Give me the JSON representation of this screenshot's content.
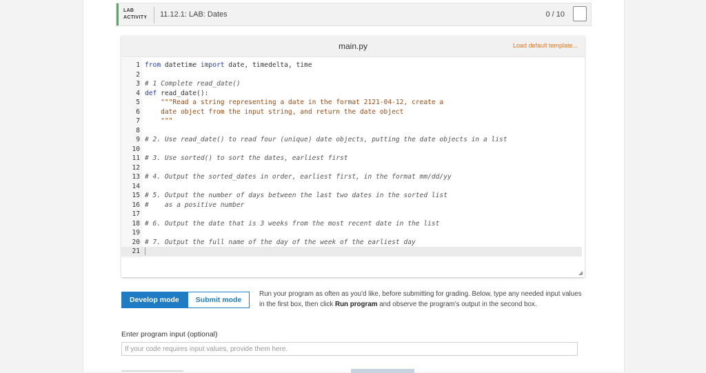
{
  "lab": {
    "badge_line1": "LAB",
    "badge_line2": "ACTIVITY",
    "title": "11.12.1: LAB: Dates",
    "score": "0 / 10"
  },
  "editor": {
    "file_name": "main.py",
    "load_template_label": "Load default template...",
    "lines": [
      {
        "n": "1",
        "segments": [
          {
            "t": "from",
            "c": "kw"
          },
          {
            "t": " datetime ",
            "c": ""
          },
          {
            "t": "import",
            "c": "kw"
          },
          {
            "t": " date, timedelta, time",
            "c": ""
          }
        ]
      },
      {
        "n": "2",
        "segments": []
      },
      {
        "n": "3",
        "segments": [
          {
            "t": "# 1 Complete read_date()",
            "c": "cm"
          }
        ]
      },
      {
        "n": "4",
        "segments": [
          {
            "t": "def",
            "c": "kw"
          },
          {
            "t": " read_date():",
            "c": ""
          }
        ]
      },
      {
        "n": "5",
        "segments": [
          {
            "t": "    \"\"\"Read a string representing a date in the format 2121-04-12, create a",
            "c": "str"
          }
        ]
      },
      {
        "n": "6",
        "segments": [
          {
            "t": "    date object from the input string, and return the date object",
            "c": "str"
          }
        ]
      },
      {
        "n": "7",
        "segments": [
          {
            "t": "    \"\"\"",
            "c": "str"
          }
        ]
      },
      {
        "n": "8",
        "segments": []
      },
      {
        "n": "9",
        "segments": [
          {
            "t": "# 2. Use read_date() to read four (unique) date objects, putting the date objects in a list",
            "c": "cm"
          }
        ]
      },
      {
        "n": "10",
        "segments": []
      },
      {
        "n": "11",
        "segments": [
          {
            "t": "# 3. Use sorted() to sort the dates, earliest first",
            "c": "cm"
          }
        ]
      },
      {
        "n": "12",
        "segments": []
      },
      {
        "n": "13",
        "segments": [
          {
            "t": "# 4. Output the sorted_dates in order, earliest first, in the format mm/dd/yy",
            "c": "cm"
          }
        ]
      },
      {
        "n": "14",
        "segments": []
      },
      {
        "n": "15",
        "segments": [
          {
            "t": "# 5. Output the number of days between the last two dates in the sorted list",
            "c": "cm"
          }
        ]
      },
      {
        "n": "16",
        "segments": [
          {
            "t": "#    as a positive number",
            "c": "cm"
          }
        ]
      },
      {
        "n": "17",
        "segments": []
      },
      {
        "n": "18",
        "segments": [
          {
            "t": "# 6. Output the date that is 3 weeks from the most recent date in the list",
            "c": "cm"
          }
        ]
      },
      {
        "n": "19",
        "segments": []
      },
      {
        "n": "20",
        "segments": [
          {
            "t": "# 7. Output the full name of the day of the week of the earliest day",
            "c": "cm"
          }
        ]
      },
      {
        "n": "21",
        "segments": [],
        "active": true
      }
    ]
  },
  "modes": {
    "develop_label": "Develop mode",
    "submit_label": "Submit mode",
    "help_before": "Run your program as often as you'd like, before submitting for grading. Below, type any needed input values in the first box, then click ",
    "help_bold": "Run program",
    "help_after": " and observe the program's output in the second box."
  },
  "input": {
    "label": "Enter program input (optional)",
    "placeholder": "If your code requires input values, provide them here."
  },
  "colors": {
    "accent_green": "#4caf50",
    "link_orange": "#e8761b",
    "primary_blue": "#1f7bc3"
  }
}
